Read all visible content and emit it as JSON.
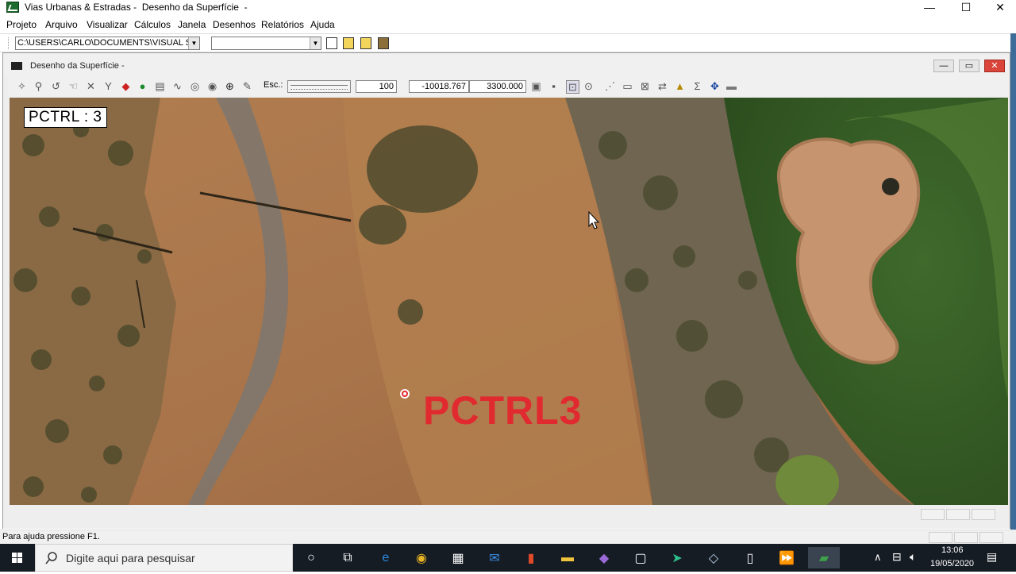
{
  "window": {
    "title": "Vias Urbanas & Estradas -  Desenho da Superfície  -",
    "minimize": "—",
    "maximize": "☐",
    "close": "✕"
  },
  "menu": [
    "Projeto",
    "Arquivo",
    "Visualizar",
    "Cálculos",
    "Janela",
    "Desenhos",
    "Relatórios",
    "Ajuda"
  ],
  "toolbar1": {
    "path_value": "C:\\USERS\\CARLO\\DOCUMENTS\\VISUAL ST",
    "second_combo_value": ""
  },
  "inner_window": {
    "title": "Desenho da Superfície  -",
    "minimize": "—",
    "restore": "▭",
    "close": "✕"
  },
  "toolbar2": {
    "scale_label": "Esc.:",
    "scale_value": "100",
    "coord_x": "-10018.767",
    "coord_y": "3300.000"
  },
  "map": {
    "point_label": "PCTRL : 3",
    "point_name": "PCTRL3",
    "point_color": "#e12a30"
  },
  "status": {
    "help_text": "Para ajuda pressione F1."
  },
  "taskbar": {
    "search_placeholder": "Digite aqui para pesquisar",
    "time": "13:06",
    "date": "19/05/2020"
  }
}
